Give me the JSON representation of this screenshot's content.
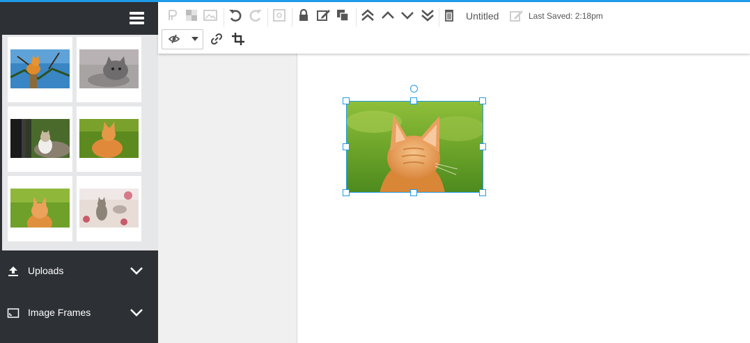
{
  "document": {
    "title": "Untitled",
    "last_saved": "Last Saved: 2:18pm"
  },
  "sidebar": {
    "thumbnails": [
      {
        "name": "kitten-on-post-photo"
      },
      {
        "name": "gray-tabby-kitten-photo"
      },
      {
        "name": "white-cat-by-fence-photo"
      },
      {
        "name": "orange-kitten-profile-photo"
      },
      {
        "name": "orange-kitten-back-photo"
      },
      {
        "name": "tabby-kitten-on-blanket-photo"
      }
    ],
    "panels": [
      {
        "label": "Uploads",
        "icon": "upload-icon"
      },
      {
        "label": "Image Frames",
        "icon": "image-frame-icon"
      }
    ]
  },
  "toolbar": {
    "icons": [
      "paragraph-icon",
      "transparency-icon",
      "image-icon",
      "undo-icon",
      "redo-icon",
      "zoom-fit-icon",
      "lock-icon",
      "edit-icon",
      "duplicate-icon",
      "bring-to-front-icon",
      "bring-forward-icon",
      "send-backward-icon",
      "send-to-back-icon",
      "delete-icon",
      "rename-icon",
      "visibility-icon",
      "link-icon",
      "crop-icon"
    ]
  },
  "colors": {
    "accent": "#1e9be8",
    "sidebar": "#2d3035",
    "gallery": "#e6e7e9"
  }
}
